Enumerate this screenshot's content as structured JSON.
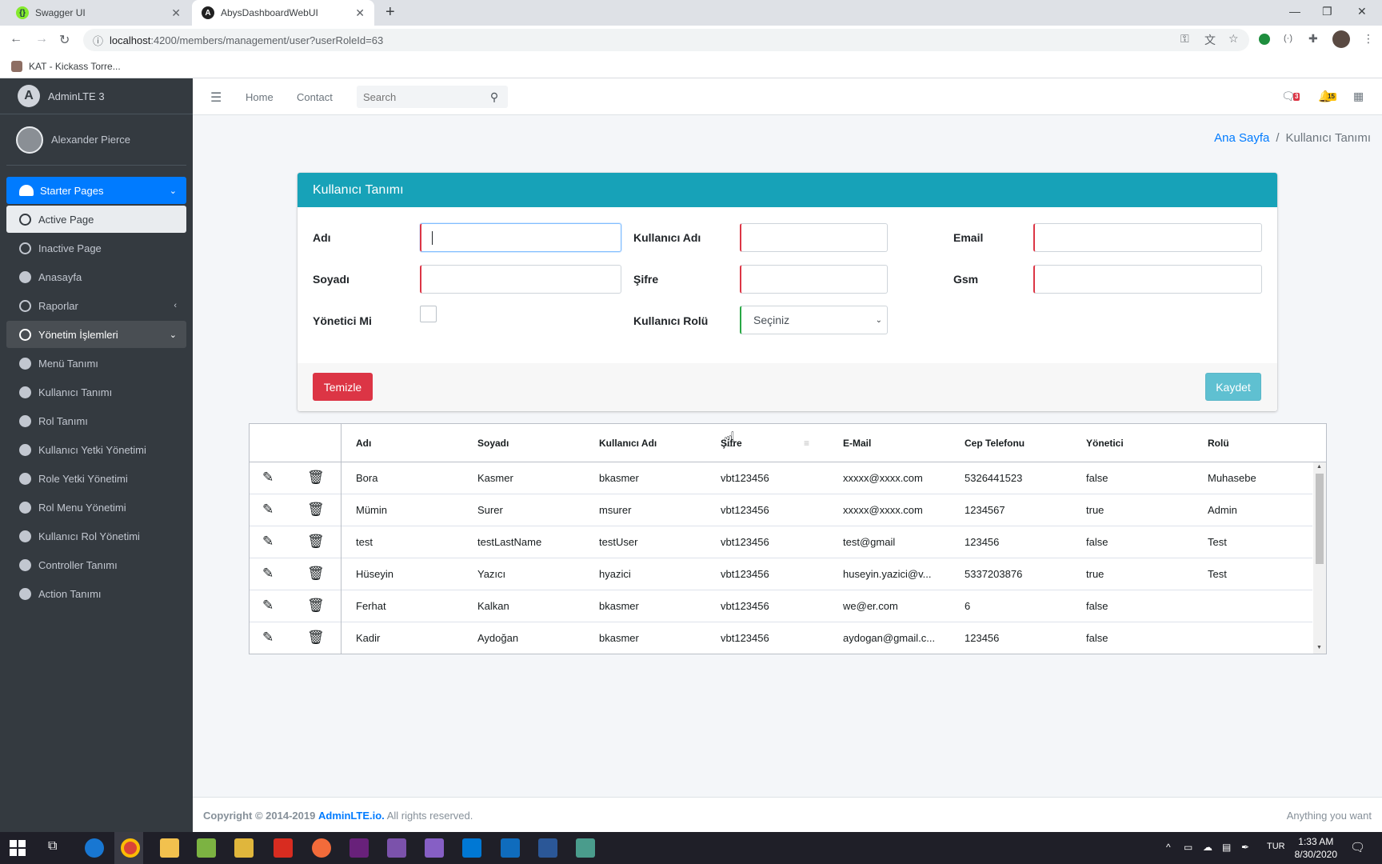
{
  "browser": {
    "tabs": [
      {
        "label": "Swagger UI",
        "icon": "swagger-icon",
        "color": "#85ea2d"
      },
      {
        "label": "AbysDashboardWebUI",
        "icon": "angular-icon",
        "color": "#212121"
      }
    ],
    "url_host": "localhost",
    "url_path": ":4200/members/management/user?userRoleId=63",
    "bookmark": "KAT - Kickass Torre..."
  },
  "sidebar": {
    "brand": "AdminLTE 3",
    "user": "Alexander Pierce",
    "items": [
      {
        "label": "Starter Pages"
      },
      {
        "label": "Active Page"
      },
      {
        "label": "Inactive Page"
      },
      {
        "label": "Anasayfa"
      },
      {
        "label": "Raporlar"
      },
      {
        "label": "Yönetim İşlemleri"
      },
      {
        "label": "Menü Tanımı"
      },
      {
        "label": "Kullanıcı Tanımı"
      },
      {
        "label": "Rol Tanımı"
      },
      {
        "label": "Kullanıcı Yetki Yönetimi"
      },
      {
        "label": "Role Yetki Yönetimi"
      },
      {
        "label": "Rol Menu Yönetimi"
      },
      {
        "label": "Kullanıcı Rol Yönetimi"
      },
      {
        "label": "Controller Tanımı"
      },
      {
        "label": "Action Tanımı"
      }
    ]
  },
  "topnav": {
    "home": "Home",
    "contact": "Contact",
    "search_placeholder": "Search",
    "messages_badge": "3",
    "notifications_badge": "15"
  },
  "breadcrumb": {
    "home": "Ana Sayfa",
    "current": "Kullanıcı Tanımı"
  },
  "form": {
    "title": "Kullanıcı Tanımı",
    "labels": {
      "first_name": "Adı",
      "username": "Kullanıcı Adı",
      "email": "Email",
      "last_name": "Soyadı",
      "password": "Şifre",
      "gsm": "Gsm",
      "is_admin": "Yönetici Mi",
      "role": "Kullanıcı Rolü"
    },
    "role_selected": "Seçiniz",
    "clear_button": "Temizle",
    "save_button": "Kaydet"
  },
  "grid": {
    "columns": [
      "Adı",
      "Soyadı",
      "Kullanıcı Adı",
      "Şifre",
      "E-Mail",
      "Cep Telefonu",
      "Yönetici",
      "Rolü"
    ],
    "rows": [
      [
        "Bora",
        "Kasmer",
        "bkasmer",
        "vbt123456",
        "xxxxx@xxxx.com",
        "5326441523",
        "false",
        "Muhasebe"
      ],
      [
        "Mümin",
        "Surer",
        "msurer",
        "vbt123456",
        "xxxxx@xxxx.com",
        "1234567",
        "true",
        "Admin"
      ],
      [
        "test",
        "testLastName",
        "testUser",
        "vbt123456",
        "test@gmail",
        "123456",
        "false",
        "Test"
      ],
      [
        "Hüseyin",
        "Yazıcı",
        "hyazici",
        "vbt123456",
        "huseyin.yazici@v...",
        "5337203876",
        "true",
        "Test"
      ],
      [
        "Ferhat",
        "Kalkan",
        "bkasmer",
        "vbt123456",
        "we@er.com",
        "6",
        "false",
        ""
      ],
      [
        "Kadir",
        "Aydoğan",
        "bkasmer",
        "vbt123456",
        "aydogan@gmail.c...",
        "123456",
        "false",
        ""
      ]
    ]
  },
  "footer": {
    "copyright": "Copyright © 2014-2019",
    "brand_link": "AdminLTE.io.",
    "rights": "All rights reserved.",
    "right_text": "Anything you want"
  },
  "taskbar": {
    "language": "TUR",
    "time": "1:33 AM",
    "date": "8/30/2020"
  }
}
